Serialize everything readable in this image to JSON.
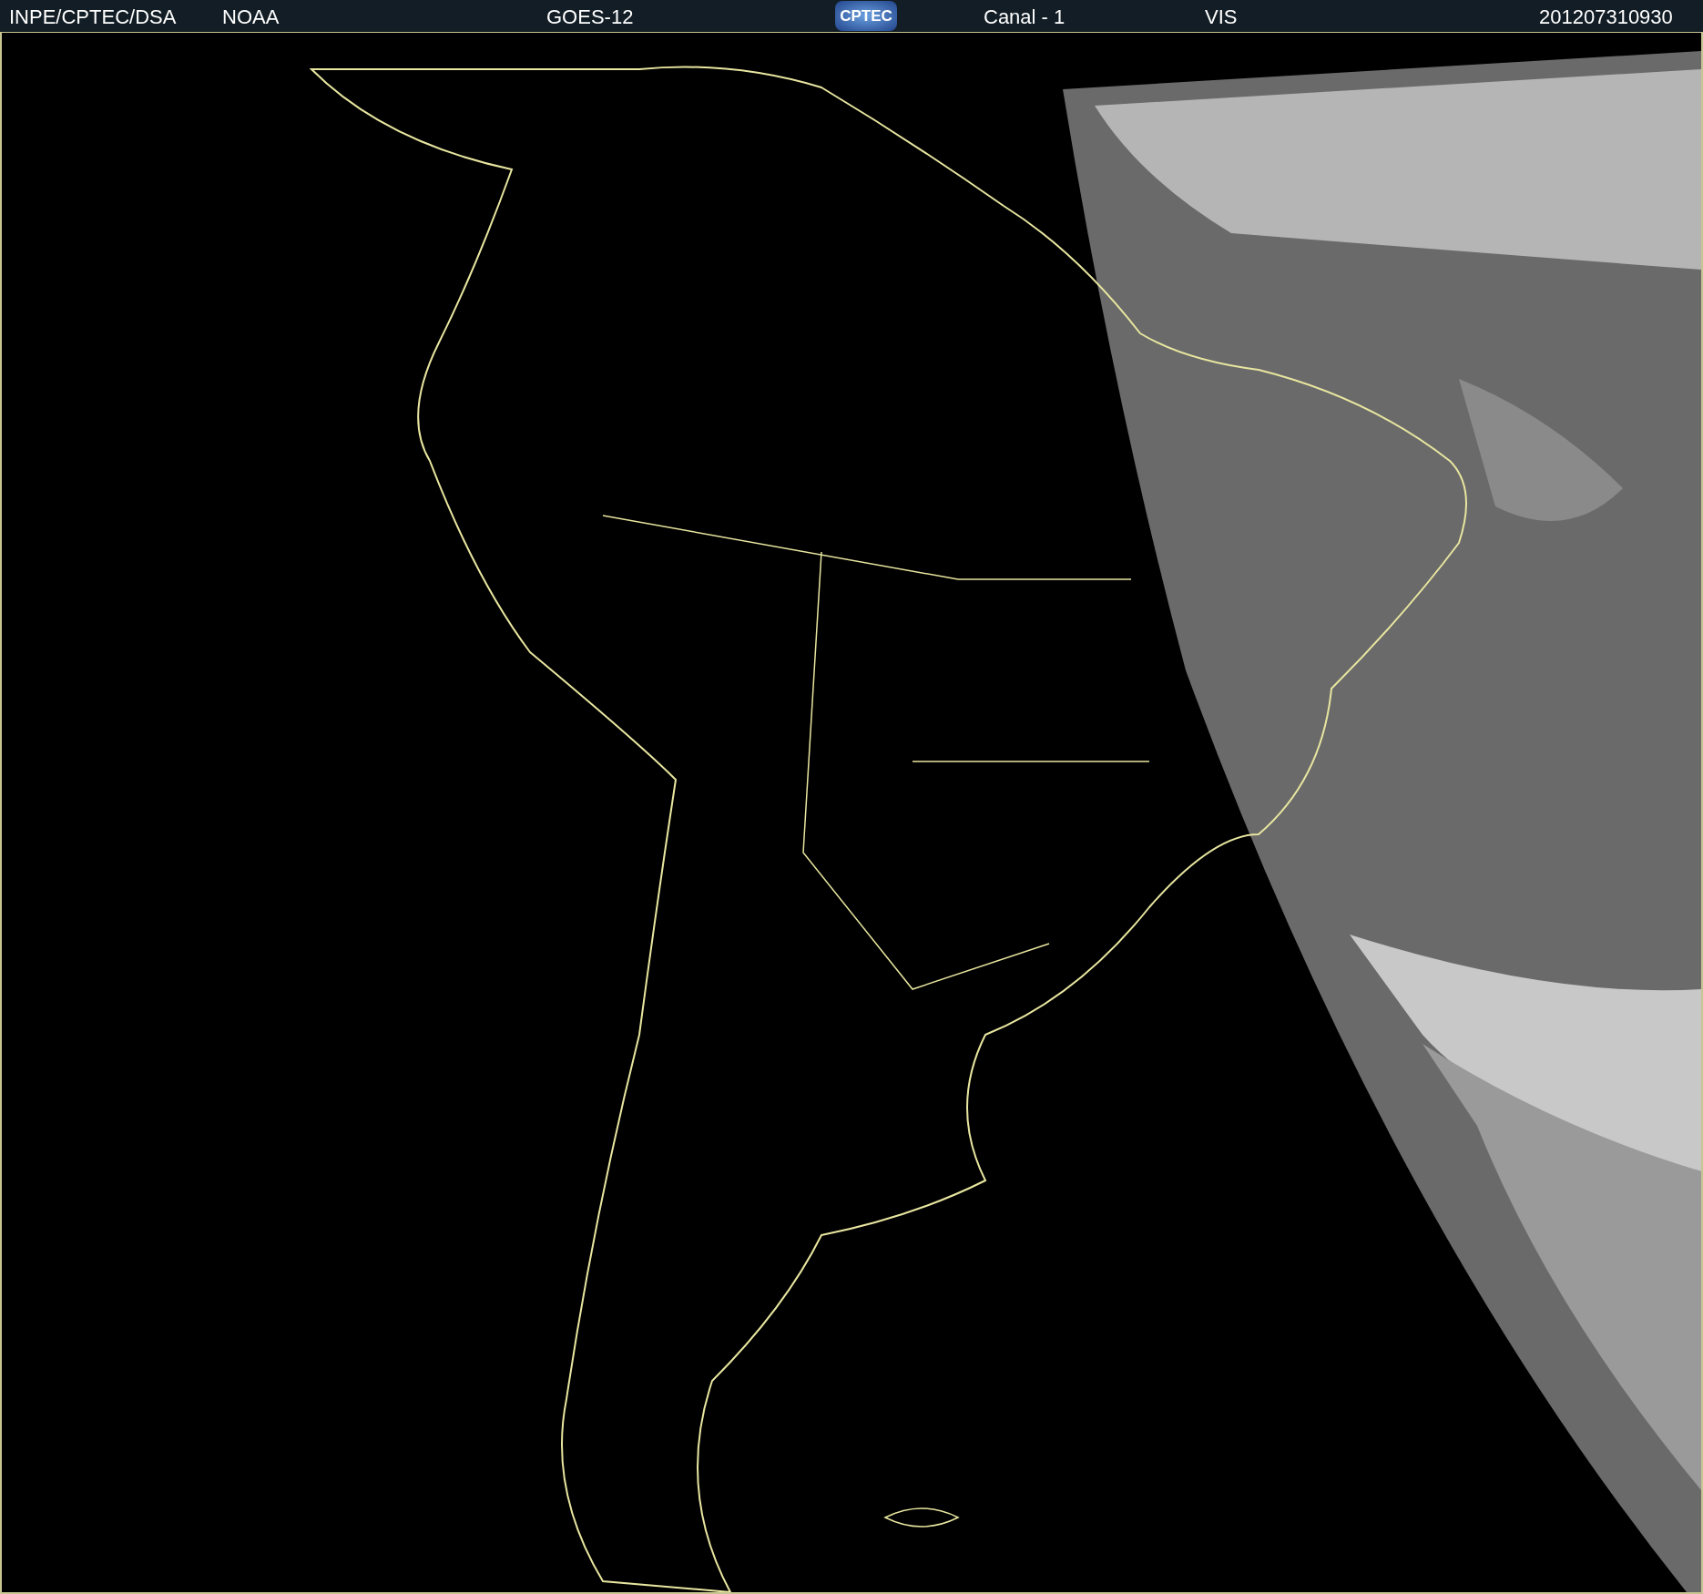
{
  "header": {
    "source": "INPE/CPTEC/DSA",
    "agency": "NOAA",
    "satellite": "GOES-12",
    "logo": "CPTEC",
    "channel": "Canal - 1",
    "band": "VIS",
    "timestamp": "201207310930"
  }
}
